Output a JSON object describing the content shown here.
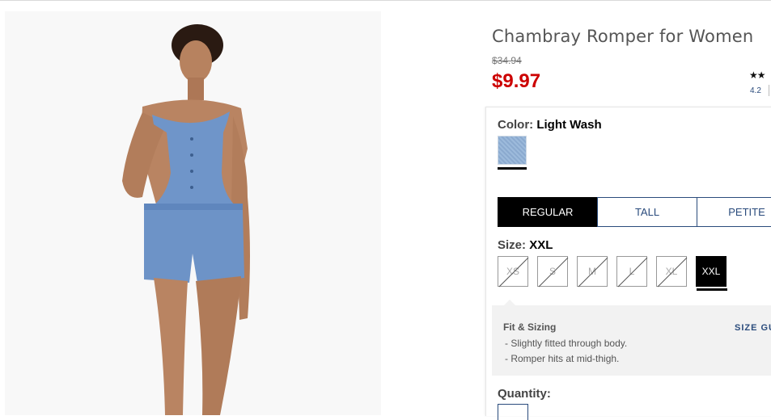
{
  "product": {
    "title": "Chambray Romper for Women",
    "original_price": "$34.94",
    "sale_price": "$9.97",
    "rating_stars": "★★",
    "rating_value": "4.2"
  },
  "color": {
    "label": "Color:",
    "selected": "Light Wash",
    "swatch_color": "#8fb0d6"
  },
  "fit_tabs": [
    {
      "label": "REGULAR",
      "active": true
    },
    {
      "label": "TALL",
      "active": false
    },
    {
      "label": "PETITE",
      "active": false
    }
  ],
  "size": {
    "label": "Size:",
    "selected": "XXL",
    "options": [
      {
        "label": "XS",
        "available": false
      },
      {
        "label": "S",
        "available": false
      },
      {
        "label": "M",
        "available": false
      },
      {
        "label": "L",
        "available": false
      },
      {
        "label": "XL",
        "available": false
      },
      {
        "label": "XXL",
        "available": true,
        "selected": true
      }
    ]
  },
  "fit_sizing": {
    "title": "Fit & Sizing",
    "guide_link": "SIZE GU",
    "bullets": [
      "- Slightly fitted through body.",
      "- Romper hits at mid-thigh."
    ]
  },
  "quantity": {
    "label": "Quantity:"
  },
  "colors": {
    "sale_red": "#cc0000",
    "link_navy": "#2a4b7c",
    "selected_black": "#000000",
    "fit_panel_bg": "#f2f2f2"
  }
}
